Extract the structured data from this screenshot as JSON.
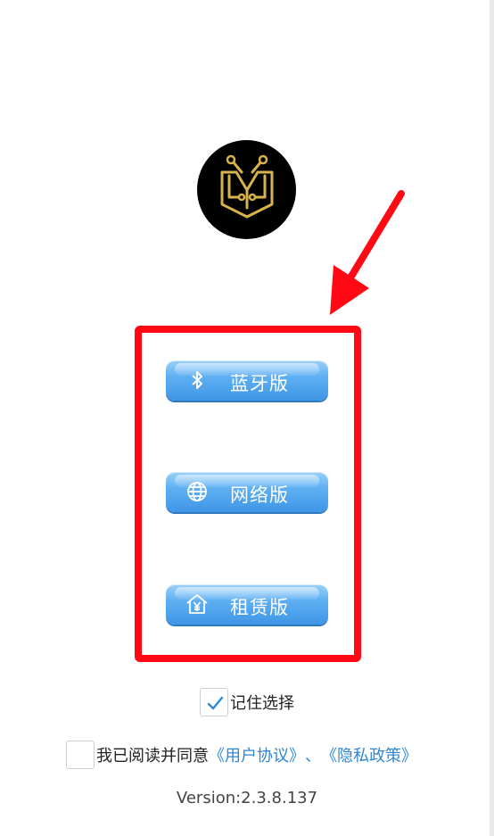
{
  "logo": {
    "icon": "circuit-m-logo-icon",
    "colors": {
      "background": "#000000",
      "gold": "#d8b24a"
    }
  },
  "mode_buttons": [
    {
      "label": "蓝牙版",
      "icon": "bluetooth-icon"
    },
    {
      "label": "网络版",
      "icon": "globe-icon"
    },
    {
      "label": "租赁版",
      "icon": "house-yen-icon"
    }
  ],
  "remember": {
    "label": "记住选择",
    "checked": true
  },
  "agreement": {
    "prefix": "我已阅读并同意",
    "user_agreement": "《用户协议》",
    "separator": "、",
    "privacy_policy": "《隐私政策》",
    "checked": false
  },
  "version": "Version:2.3.8.137",
  "annotation": {
    "color": "#ff0a14",
    "type": "arrow-and-highlight-box"
  },
  "colors": {
    "button_top": "#9ad0f8",
    "button_bottom": "#3f96e6",
    "link": "#2f86d4",
    "check": "#2b8ad6"
  }
}
